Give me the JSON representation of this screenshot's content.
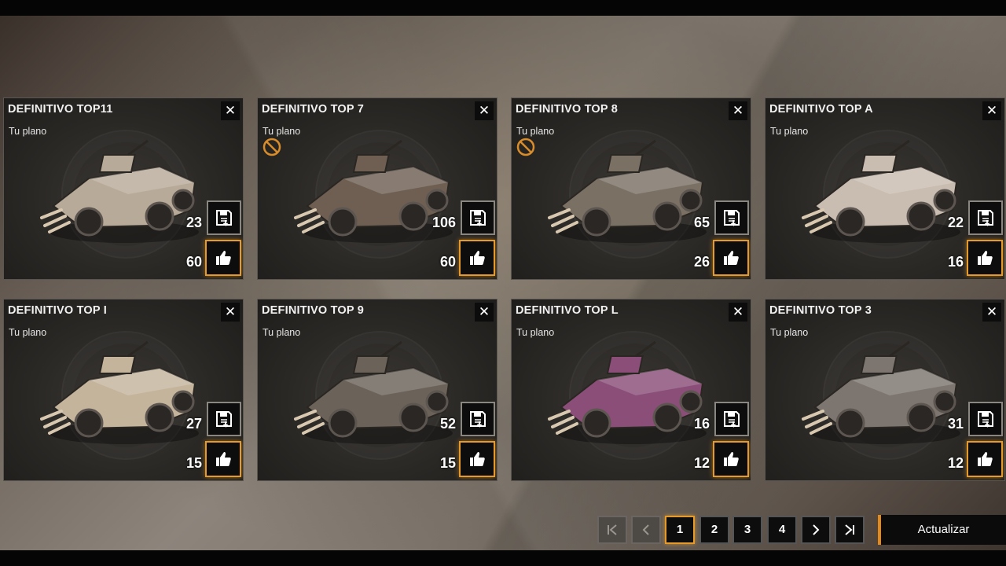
{
  "cards": [
    {
      "title": "DEFINITIVO TOP11",
      "subtitle": "Tu plano",
      "saves": "23",
      "likes": "60",
      "banned": false,
      "vehicle_color": "#b7aa98"
    },
    {
      "title": "DEFINITIVO TOP 7",
      "subtitle": "Tu plano",
      "saves": "106",
      "likes": "60",
      "banned": true,
      "vehicle_color": "#6e5f52"
    },
    {
      "title": "DEFINITIVO TOP 8",
      "subtitle": "Tu plano",
      "saves": "65",
      "likes": "26",
      "banned": true,
      "vehicle_color": "#7a7064"
    },
    {
      "title": "DEFINITIVO TOP A",
      "subtitle": "Tu plano",
      "saves": "22",
      "likes": "16",
      "banned": false,
      "vehicle_color": "#c9bcb0"
    },
    {
      "title": "DEFINITIVO TOP I",
      "subtitle": "Tu plano",
      "saves": "27",
      "likes": "15",
      "banned": false,
      "vehicle_color": "#c4b49c"
    },
    {
      "title": "DEFINITIVO TOP 9",
      "subtitle": "Tu plano",
      "saves": "52",
      "likes": "15",
      "banned": false,
      "vehicle_color": "#6b6259"
    },
    {
      "title": "DEFINITIVO TOP L",
      "subtitle": "Tu plano",
      "saves": "16",
      "likes": "12",
      "banned": false,
      "vehicle_color": "#8a4e78"
    },
    {
      "title": "DEFINITIVO TOP 3",
      "subtitle": "Tu plano",
      "saves": "31",
      "likes": "12",
      "banned": false,
      "vehicle_color": "#7d7670"
    }
  ],
  "pagination": {
    "first_icon": "first-page-icon",
    "prev_icon": "prev-page-icon",
    "pages": [
      "1",
      "2",
      "3",
      "4"
    ],
    "current_page": "1",
    "next_icon": "next-page-icon",
    "last_icon": "last-page-icon"
  },
  "refresh_label": "Actualizar",
  "colors": {
    "accent": "#e59a2a",
    "ban": "#d98c2a"
  }
}
